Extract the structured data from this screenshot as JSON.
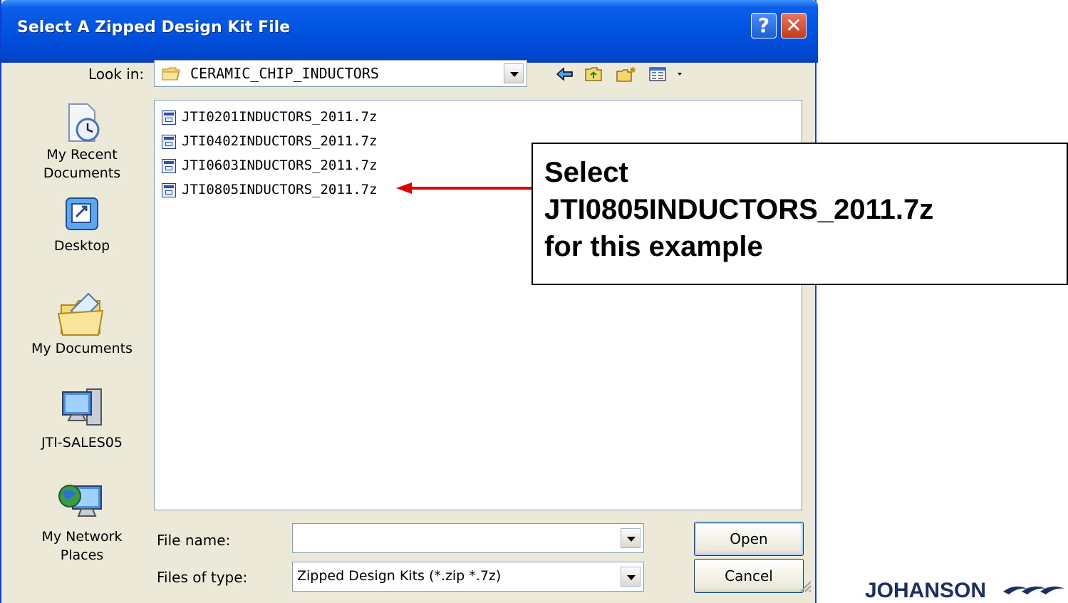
{
  "dialog": {
    "title": "Select A Zipped Design Kit File",
    "help_label": "?",
    "close_label": "✕"
  },
  "lookin": {
    "label": "Look in:",
    "value": "CERAMIC_CHIP_INDUCTORS"
  },
  "toolbar": {
    "icons": [
      "back-arrow-icon",
      "up-folder-icon",
      "new-folder-icon",
      "view-menu-icon"
    ]
  },
  "places": [
    {
      "label": "My Recent\nDocuments",
      "icon": "recent-documents-icon"
    },
    {
      "label": "Desktop",
      "icon": "desktop-icon"
    },
    {
      "label": "My Documents",
      "icon": "my-documents-icon"
    },
    {
      "label": "JTI-SALES05",
      "icon": "my-computer-icon"
    },
    {
      "label": "My Network\nPlaces",
      "icon": "network-places-icon"
    }
  ],
  "files": [
    "JTI0201INDUCTORS_2011.7z",
    "JTI0402INDUCTORS_2011.7z",
    "JTI0603INDUCTORS_2011.7z",
    "JTI0805INDUCTORS_2011.7z"
  ],
  "filename": {
    "label": "File name:",
    "value": ""
  },
  "filetype": {
    "label": "Files of type:",
    "value": "Zipped Design Kits (*.zip *.7z)"
  },
  "buttons": {
    "open": "Open",
    "cancel": "Cancel"
  },
  "callout": {
    "text": "Select\nJTI0805INDUCTORS_2011.7z\nfor this example"
  },
  "logo": {
    "text": "JOHANSON"
  },
  "colors": {
    "titlebar": "#0053e1",
    "dialog_bg": "#ece9d8",
    "arrow": "#e00000",
    "logo": "#1b2f63"
  }
}
